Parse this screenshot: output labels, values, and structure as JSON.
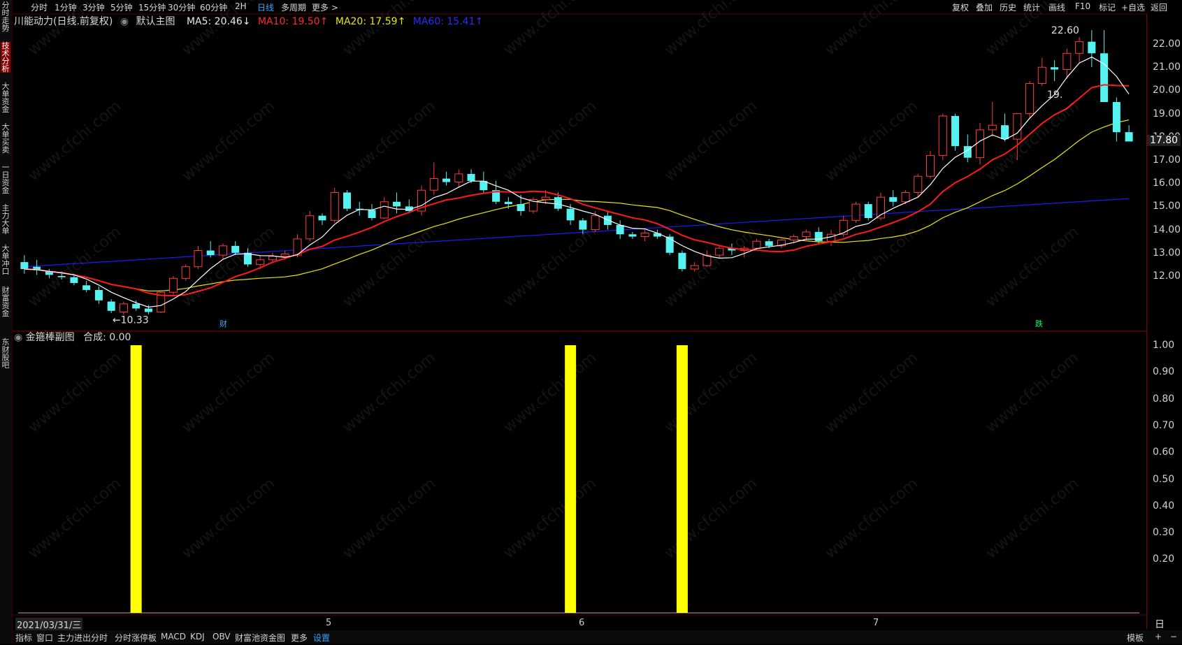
{
  "window": {
    "title": "川能动力"
  },
  "sidebar": [
    {
      "label": "分时走势",
      "active": false
    },
    {
      "label": "技术分析",
      "active": true
    },
    {
      "label": "大单资金",
      "active": false
    },
    {
      "label": "大单买卖",
      "active": false
    },
    {
      "label": "一日资金",
      "active": false
    },
    {
      "label": "主力大单",
      "active": false
    },
    {
      "label": "大单冲口",
      "active": false
    },
    {
      "label": "财富资金",
      "active": false
    },
    {
      "label": "东财股吧",
      "active": false
    }
  ],
  "toolbar": {
    "periods": [
      "分时",
      "1分钟",
      "3分钟",
      "5分钟",
      "15分钟",
      "30分钟",
      "60分钟",
      "2H",
      "日线",
      "多周期",
      "更多 >"
    ],
    "active_period": "日线",
    "right_buttons": [
      "复权",
      "叠加",
      "历史",
      "统计",
      "画线",
      "F10",
      "标记",
      "+自选",
      "返回"
    ]
  },
  "legend": {
    "name": "川能动力(日线.前复权)",
    "template": "默认主图",
    "ma5": "MA5: 20.46↓",
    "ma10": "MA10: 19.50↑",
    "ma20": "MA20: 17.59↑",
    "ma60": "MA60: 15.41↑"
  },
  "colors": {
    "up": "#ff3b3b",
    "down": "#55f2f2",
    "ma5": "#ffffff",
    "ma10": "#ff1a1a",
    "ma20": "#e8e800",
    "ma60": "#1a1aff",
    "indicator": "#ffff00",
    "accent": "#33a3ff"
  },
  "price_axis": [
    "22.00",
    "21.00",
    "20.00",
    "19.00",
    "18.00",
    "17.00",
    "16.00",
    "15.00",
    "14.00",
    "13.00",
    "12.00"
  ],
  "annotations": {
    "high_label": "22.60",
    "low_label": "←10.33",
    "current_price": "17.80",
    "right_clip": "19.",
    "cai_marker": "财",
    "die_marker": "跌"
  },
  "sub_panel": {
    "title": "金箍棒副图",
    "value": "合成: 0.00",
    "axis": [
      "1.00",
      "0.90",
      "0.80",
      "0.70",
      "0.60",
      "0.50",
      "0.40",
      "0.30",
      "0.20"
    ],
    "bars_at_index": [
      9,
      44,
      53
    ]
  },
  "date_axis": {
    "start": "2021/03/31/三",
    "months": [
      "5",
      "6",
      "7"
    ],
    "right_label": "日线"
  },
  "bottombar": {
    "items": [
      "指标",
      "窗口",
      "主力进出分时",
      "分时涨停板",
      "MACD",
      "KDJ",
      "OBV",
      "财富池资金图",
      "更多",
      "设置"
    ],
    "active": "设置",
    "right_items": [
      "模板",
      "+",
      "−"
    ]
  },
  "watermark": "www.cfchi.com",
  "candles": [
    [
      12.6,
      12.9,
      12.1,
      12.3
    ],
    [
      12.4,
      12.7,
      12.05,
      12.25
    ],
    [
      12.2,
      12.3,
      11.9,
      12.05
    ],
    [
      12.0,
      12.2,
      11.85,
      11.95
    ],
    [
      11.95,
      12.1,
      11.6,
      11.7
    ],
    [
      11.6,
      11.8,
      11.3,
      11.4
    ],
    [
      11.4,
      11.55,
      10.8,
      10.95
    ],
    [
      10.9,
      11.0,
      10.4,
      10.5
    ],
    [
      10.45,
      10.9,
      10.33,
      10.8
    ],
    [
      10.8,
      10.95,
      10.5,
      10.6
    ],
    [
      10.6,
      10.75,
      10.35,
      10.45
    ],
    [
      10.45,
      11.4,
      10.4,
      11.3
    ],
    [
      11.3,
      12.0,
      11.2,
      11.9
    ],
    [
      11.9,
      12.5,
      11.8,
      12.4
    ],
    [
      12.4,
      13.3,
      12.3,
      13.1
    ],
    [
      13.1,
      13.5,
      12.8,
      12.9
    ],
    [
      12.9,
      13.4,
      12.7,
      13.3
    ],
    [
      13.3,
      13.5,
      12.9,
      13.0
    ],
    [
      13.0,
      13.2,
      12.4,
      12.5
    ],
    [
      12.5,
      12.9,
      12.3,
      12.7
    ],
    [
      12.7,
      13.0,
      12.55,
      12.85
    ],
    [
      12.85,
      13.1,
      12.7,
      12.95
    ],
    [
      12.9,
      13.8,
      12.8,
      13.6
    ],
    [
      13.6,
      14.8,
      13.5,
      14.6
    ],
    [
      14.6,
      14.7,
      14.2,
      14.4
    ],
    [
      14.4,
      15.8,
      14.3,
      15.6
    ],
    [
      15.6,
      15.7,
      14.8,
      14.9
    ],
    [
      14.9,
      15.2,
      14.6,
      14.85
    ],
    [
      14.85,
      15.1,
      14.4,
      14.5
    ],
    [
      14.5,
      15.4,
      14.45,
      15.2
    ],
    [
      15.2,
      15.6,
      14.7,
      15.0
    ],
    [
      15.0,
      15.3,
      14.7,
      14.8
    ],
    [
      14.8,
      15.9,
      14.6,
      15.7
    ],
    [
      15.7,
      16.9,
      15.5,
      16.2
    ],
    [
      16.2,
      16.5,
      15.9,
      16.05
    ],
    [
      16.05,
      16.6,
      15.8,
      16.4
    ],
    [
      16.4,
      16.6,
      16.0,
      16.1
    ],
    [
      16.1,
      16.5,
      15.6,
      15.7
    ],
    [
      15.7,
      16.1,
      15.1,
      15.2
    ],
    [
      15.2,
      15.4,
      14.9,
      15.1
    ],
    [
      15.1,
      15.5,
      14.6,
      14.8
    ],
    [
      14.8,
      15.4,
      14.7,
      15.3
    ],
    [
      15.3,
      15.7,
      15.1,
      15.4
    ],
    [
      15.4,
      15.6,
      14.8,
      14.9
    ],
    [
      14.9,
      15.1,
      14.2,
      14.4
    ],
    [
      14.4,
      14.5,
      13.8,
      14.0
    ],
    [
      14.0,
      14.8,
      13.9,
      14.6
    ],
    [
      14.6,
      14.8,
      14.0,
      14.2
    ],
    [
      14.2,
      14.4,
      13.6,
      13.8
    ],
    [
      13.8,
      13.9,
      13.6,
      13.7
    ],
    [
      13.7,
      14.0,
      13.5,
      13.85
    ],
    [
      13.85,
      14.0,
      13.6,
      13.7
    ],
    [
      13.7,
      13.8,
      12.9,
      13.0
    ],
    [
      13.0,
      13.1,
      12.2,
      12.3
    ],
    [
      12.3,
      12.6,
      12.2,
      12.45
    ],
    [
      12.45,
      13.1,
      12.4,
      12.9
    ],
    [
      12.9,
      13.3,
      12.8,
      13.2
    ],
    [
      13.2,
      13.4,
      12.9,
      13.1
    ],
    [
      13.1,
      13.3,
      12.8,
      13.2
    ],
    [
      13.2,
      13.6,
      13.1,
      13.5
    ],
    [
      13.5,
      13.6,
      13.2,
      13.3
    ],
    [
      13.3,
      13.6,
      13.2,
      13.55
    ],
    [
      13.55,
      13.8,
      13.4,
      13.7
    ],
    [
      13.7,
      14.0,
      13.5,
      13.9
    ],
    [
      13.9,
      14.1,
      13.4,
      13.5
    ],
    [
      13.5,
      14.0,
      13.3,
      13.8
    ],
    [
      13.8,
      14.6,
      13.7,
      14.4
    ],
    [
      14.4,
      15.2,
      14.3,
      15.1
    ],
    [
      15.1,
      15.2,
      14.4,
      14.5
    ],
    [
      14.5,
      15.6,
      14.4,
      15.4
    ],
    [
      15.4,
      15.7,
      15.0,
      15.2
    ],
    [
      15.2,
      15.7,
      15.1,
      15.6
    ],
    [
      15.6,
      16.4,
      15.4,
      16.3
    ],
    [
      16.3,
      17.4,
      16.2,
      17.2
    ],
    [
      17.2,
      19.0,
      17.0,
      18.9
    ],
    [
      18.9,
      19.0,
      17.4,
      17.6
    ],
    [
      17.6,
      18.1,
      16.9,
      17.1
    ],
    [
      17.1,
      18.6,
      16.8,
      18.3
    ],
    [
      18.3,
      19.5,
      18.0,
      18.5
    ],
    [
      18.5,
      19.0,
      17.8,
      17.9
    ],
    [
      17.9,
      19.0,
      17.0,
      19.0
    ],
    [
      19.0,
      20.4,
      18.8,
      20.3
    ],
    [
      20.3,
      21.4,
      20.2,
      21.0
    ],
    [
      21.0,
      21.3,
      20.4,
      20.9
    ],
    [
      20.9,
      21.8,
      20.5,
      21.6
    ],
    [
      21.6,
      22.3,
      21.2,
      22.1
    ],
    [
      22.1,
      22.6,
      21.0,
      21.6
    ],
    [
      21.6,
      22.6,
      19.6,
      19.5
    ],
    [
      19.5,
      19.7,
      17.8,
      18.2
    ],
    [
      18.2,
      18.5,
      17.8,
      17.8
    ]
  ]
}
